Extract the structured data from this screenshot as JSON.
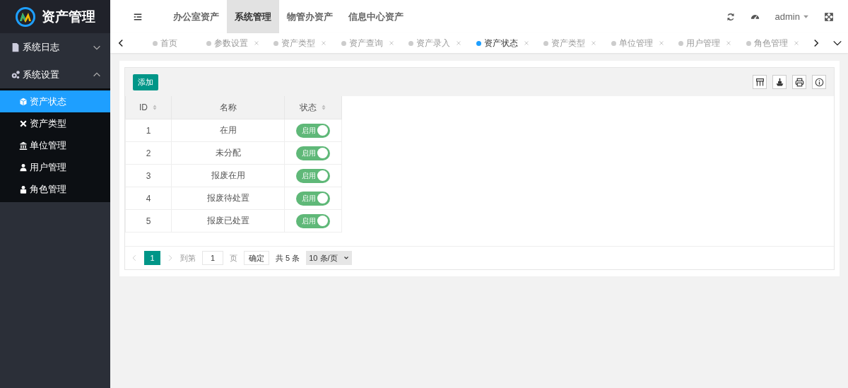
{
  "logo": {
    "title": "资产管理"
  },
  "sidebar": {
    "groups": [
      {
        "label": "系统日志",
        "expanded": false
      },
      {
        "label": "系统设置",
        "expanded": true,
        "children": [
          {
            "label": "资产状态",
            "selected": true
          },
          {
            "label": "资产类型",
            "selected": false
          },
          {
            "label": "单位管理",
            "selected": false
          },
          {
            "label": "用户管理",
            "selected": false
          },
          {
            "label": "角色管理",
            "selected": false
          }
        ]
      }
    ]
  },
  "header": {
    "nav": [
      {
        "label": "办公室资产",
        "selected": false
      },
      {
        "label": "系统管理",
        "selected": true
      },
      {
        "label": "物管办资产",
        "selected": false
      },
      {
        "label": "信息中心资产",
        "selected": false
      }
    ],
    "user": "admin"
  },
  "tabs": [
    {
      "label": "首页",
      "selected": false,
      "closable": false
    },
    {
      "label": "参数设置",
      "selected": false,
      "closable": true
    },
    {
      "label": "资产类型",
      "selected": false,
      "closable": true
    },
    {
      "label": "资产查询",
      "selected": false,
      "closable": true
    },
    {
      "label": "资产录入",
      "selected": false,
      "closable": true
    },
    {
      "label": "资产状态",
      "selected": true,
      "closable": true
    },
    {
      "label": "资产类型",
      "selected": false,
      "closable": true
    },
    {
      "label": "单位管理",
      "selected": false,
      "closable": true
    },
    {
      "label": "用户管理",
      "selected": false,
      "closable": true
    },
    {
      "label": "角色管理",
      "selected": false,
      "closable": true
    }
  ],
  "toolbar": {
    "add_button": "添加"
  },
  "table": {
    "columns": [
      {
        "label": "ID",
        "sortable": true
      },
      {
        "label": "名称",
        "sortable": false
      },
      {
        "label": "状态",
        "sortable": true
      }
    ],
    "rows": [
      {
        "id": "1",
        "name": "在用",
        "status": {
          "label": "启用",
          "on": true
        }
      },
      {
        "id": "2",
        "name": "未分配",
        "status": {
          "label": "启用",
          "on": true
        }
      },
      {
        "id": "3",
        "name": "报废在用",
        "status": {
          "label": "启用",
          "on": true
        }
      },
      {
        "id": "4",
        "name": "报废待处置",
        "status": {
          "label": "启用",
          "on": true
        }
      },
      {
        "id": "5",
        "name": "报废已处置",
        "status": {
          "label": "启用",
          "on": true
        }
      }
    ]
  },
  "pager": {
    "current": "1",
    "goto_label": "到第",
    "goto_value": "1",
    "page_label": "页",
    "confirm": "确定",
    "total": "共 5 条",
    "page_size": "10 条/页"
  }
}
